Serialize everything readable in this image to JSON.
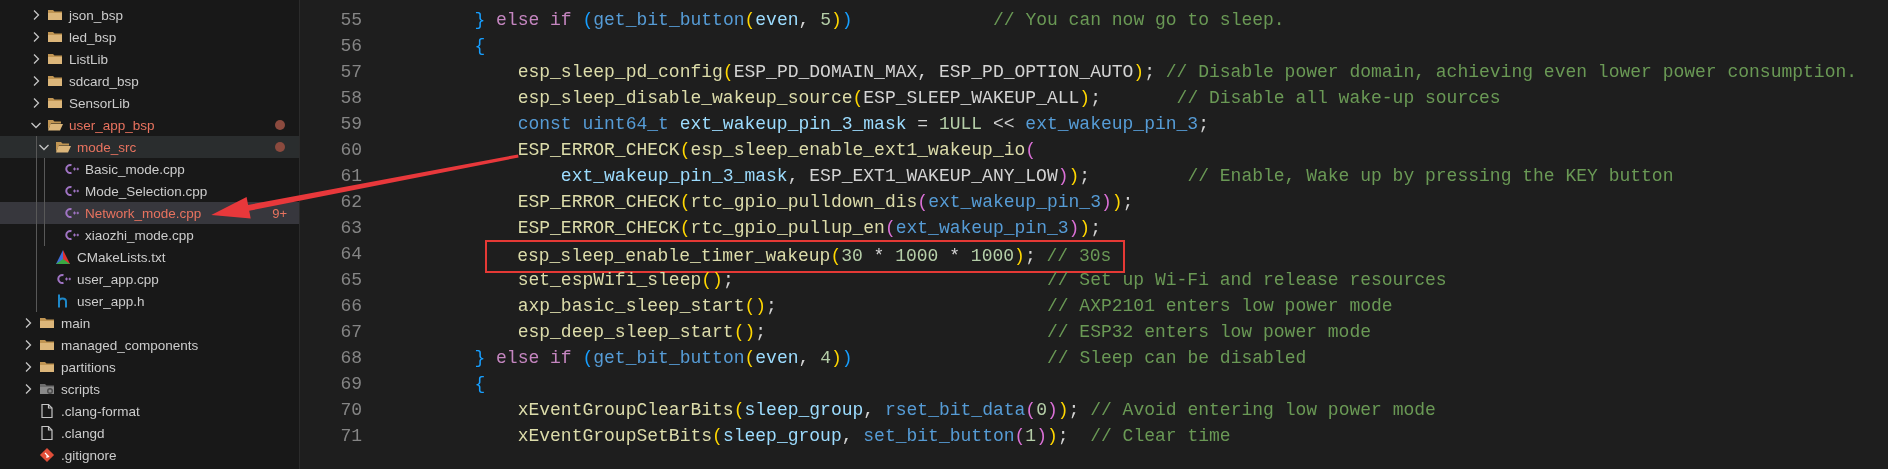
{
  "explorer": {
    "items": [
      {
        "children": [
          {
            "label": "json_bsp",
            "kind": "folder",
            "expanded": false,
            "modified": false,
            "selected": false,
            "hovered": false,
            "pointed": false
          },
          {
            "label": "led_bsp",
            "kind": "folder",
            "expanded": false,
            "modified": false,
            "selected": false,
            "hovered": false,
            "pointed": false
          },
          {
            "label": "ListLib",
            "kind": "folder",
            "expanded": false,
            "modified": false,
            "selected": false,
            "hovered": false,
            "pointed": false
          },
          {
            "label": "sdcard_bsp",
            "kind": "folder",
            "expanded": false,
            "modified": false,
            "selected": false,
            "hovered": false,
            "pointed": false
          },
          {
            "label": "SensorLib",
            "kind": "folder",
            "expanded": false,
            "modified": false,
            "selected": false,
            "hovered": false,
            "pointed": false
          },
          {
            "label": "user_app_bsp",
            "kind": "folder",
            "expanded": true,
            "modified": true,
            "selected": false,
            "hovered": false,
            "pointed": false,
            "children": [
              {
                "label": "mode_src",
                "kind": "folder",
                "expanded": true,
                "modified": true,
                "selected": false,
                "hovered": true,
                "pointed": false,
                "children": [
                  {
                    "label": "Basic_mode.cpp",
                    "kind": "cpp",
                    "modified": false,
                    "selected": false,
                    "hovered": false,
                    "pointed": false
                  },
                  {
                    "label": "Mode_Selection.cpp",
                    "kind": "cpp",
                    "modified": false,
                    "selected": false,
                    "hovered": false,
                    "pointed": false
                  },
                  {
                    "label": "Network_mode.cpp",
                    "kind": "cpp",
                    "modified": true,
                    "selected": true,
                    "hovered": false,
                    "pointed": true,
                    "badge": "9+"
                  },
                  {
                    "label": "xiaozhi_mode.cpp",
                    "kind": "cpp",
                    "modified": false,
                    "selected": false,
                    "hovered": false,
                    "pointed": false
                  }
                ]
              },
              {
                "label": "CMakeLists.txt",
                "kind": "cmake",
                "modified": false,
                "selected": false,
                "hovered": false,
                "pointed": false
              },
              {
                "label": "user_app.cpp",
                "kind": "cpp",
                "modified": false,
                "selected": false,
                "hovered": false,
                "pointed": false
              },
              {
                "label": "user_app.h",
                "kind": "header",
                "modified": false,
                "selected": false,
                "hovered": false,
                "pointed": false
              }
            ]
          }
        ]
      },
      {
        "label": "main",
        "kind": "folder",
        "expanded": false,
        "modified": false,
        "selected": false,
        "hovered": false,
        "pointed": false
      },
      {
        "label": "managed_components",
        "kind": "folder",
        "expanded": false,
        "modified": false,
        "selected": false,
        "hovered": false,
        "pointed": false
      },
      {
        "label": "partitions",
        "kind": "folder",
        "expanded": false,
        "modified": false,
        "selected": false,
        "hovered": false,
        "pointed": false
      },
      {
        "label": "scripts",
        "kind": "scripts",
        "expanded": false,
        "modified": false,
        "selected": false,
        "hovered": false,
        "pointed": false
      },
      {
        "label": ".clang-format",
        "kind": "file",
        "modified": false,
        "selected": false,
        "hovered": false,
        "pointed": false
      },
      {
        "label": ".clangd",
        "kind": "file",
        "modified": false,
        "selected": false,
        "hovered": false,
        "pointed": false
      },
      {
        "label": ".gitignore",
        "kind": "git",
        "modified": false,
        "selected": false,
        "hovered": false,
        "pointed": false
      }
    ]
  },
  "editor": {
    "lines": [
      {
        "number": "55",
        "highlighted": false,
        "tokens": [
          {
            "kind": "b3",
            "text": "        }"
          },
          {
            "kind": "kw",
            "text": " else if "
          },
          {
            "kind": "b3",
            "text": "("
          },
          {
            "kind": "blue",
            "text": "get_bit_button"
          },
          {
            "kind": "b1",
            "text": "("
          },
          {
            "kind": "var",
            "text": "even"
          },
          {
            "kind": "plain",
            "text": ", "
          },
          {
            "kind": "num",
            "text": "5"
          },
          {
            "kind": "b1",
            "text": ")"
          },
          {
            "kind": "b3",
            "text": ")             "
          },
          {
            "kind": "cm",
            "text": "// You can now go to sleep."
          }
        ]
      },
      {
        "number": "56",
        "highlighted": false,
        "tokens": [
          {
            "kind": "b3",
            "text": "        {"
          }
        ]
      },
      {
        "number": "57",
        "highlighted": false,
        "tokens": [
          {
            "kind": "fn",
            "text": "            esp_sleep_pd_config"
          },
          {
            "kind": "b1",
            "text": "("
          },
          {
            "kind": "plain",
            "text": "ESP_PD_DOMAIN_MAX, ESP_PD_OPTION_AUTO"
          },
          {
            "kind": "b1",
            "text": ")"
          },
          {
            "kind": "plain",
            "text": "; "
          },
          {
            "kind": "cm",
            "text": "// Disable power domain, achieving even lower power consumption."
          }
        ]
      },
      {
        "number": "58",
        "highlighted": false,
        "tokens": [
          {
            "kind": "fn",
            "text": "            esp_sleep_disable_wakeup_source"
          },
          {
            "kind": "b1",
            "text": "("
          },
          {
            "kind": "plain",
            "text": "ESP_SLEEP_WAKEUP_ALL"
          },
          {
            "kind": "b1",
            "text": ")"
          },
          {
            "kind": "plain",
            "text": ";       "
          },
          {
            "kind": "cm",
            "text": "// Disable all wake-up sources"
          }
        ]
      },
      {
        "number": "59",
        "highlighted": false,
        "tokens": [
          {
            "kind": "blue",
            "text": "            const uint64_t "
          },
          {
            "kind": "var",
            "text": "ext_wakeup_pin_3_mask"
          },
          {
            "kind": "plain",
            "text": " = "
          },
          {
            "kind": "num",
            "text": "1ULL"
          },
          {
            "kind": "plain",
            "text": " << "
          },
          {
            "kind": "blue",
            "text": "ext_wakeup_pin_3"
          },
          {
            "kind": "plain",
            "text": ";"
          }
        ]
      },
      {
        "number": "60",
        "highlighted": false,
        "tokens": [
          {
            "kind": "fn",
            "text": "            ESP_ERROR_CHECK"
          },
          {
            "kind": "b1",
            "text": "("
          },
          {
            "kind": "fn",
            "text": "esp_sleep_enable_ext1_wakeup_io"
          },
          {
            "kind": "b2",
            "text": "("
          }
        ]
      },
      {
        "number": "61",
        "highlighted": false,
        "tokens": [
          {
            "kind": "var",
            "text": "                ext_wakeup_pin_3_mask"
          },
          {
            "kind": "plain",
            "text": ", ESP_EXT1_WAKEUP_ANY_LOW"
          },
          {
            "kind": "b2",
            "text": ")"
          },
          {
            "kind": "b1",
            "text": ")"
          },
          {
            "kind": "plain",
            "text": ";         "
          },
          {
            "kind": "cm",
            "text": "// Enable, Wake up by pressing the KEY button"
          }
        ]
      },
      {
        "number": "62",
        "highlighted": false,
        "tokens": [
          {
            "kind": "fn",
            "text": "            ESP_ERROR_CHECK"
          },
          {
            "kind": "b1",
            "text": "("
          },
          {
            "kind": "fn",
            "text": "rtc_gpio_pulldown_dis"
          },
          {
            "kind": "b2",
            "text": "("
          },
          {
            "kind": "blue",
            "text": "ext_wakeup_pin_3"
          },
          {
            "kind": "b2",
            "text": ")"
          },
          {
            "kind": "b1",
            "text": ")"
          },
          {
            "kind": "plain",
            "text": ";"
          }
        ]
      },
      {
        "number": "63",
        "highlighted": false,
        "tokens": [
          {
            "kind": "fn",
            "text": "            ESP_ERROR_CHECK"
          },
          {
            "kind": "b1",
            "text": "("
          },
          {
            "kind": "fn",
            "text": "rtc_gpio_pullup_en"
          },
          {
            "kind": "b2",
            "text": "("
          },
          {
            "kind": "blue",
            "text": "ext_wakeup_pin_3"
          },
          {
            "kind": "b2",
            "text": ")"
          },
          {
            "kind": "b1",
            "text": ")"
          },
          {
            "kind": "plain",
            "text": ";"
          }
        ]
      },
      {
        "number": "64",
        "highlighted": true,
        "tokens": [
          {
            "kind": "fn",
            "text": "            esp_sleep_enable_timer_wakeup"
          },
          {
            "kind": "b1",
            "text": "("
          },
          {
            "kind": "num",
            "text": "30"
          },
          {
            "kind": "plain",
            "text": " * "
          },
          {
            "kind": "num",
            "text": "1000"
          },
          {
            "kind": "plain",
            "text": " * "
          },
          {
            "kind": "num",
            "text": "1000"
          },
          {
            "kind": "b1",
            "text": ")"
          },
          {
            "kind": "plain",
            "text": "; "
          },
          {
            "kind": "cm",
            "text": "// 30s"
          }
        ]
      },
      {
        "number": "65",
        "highlighted": false,
        "tokens": [
          {
            "kind": "fn",
            "text": "            set_espWifi_sleep"
          },
          {
            "kind": "b1",
            "text": "()"
          },
          {
            "kind": "plain",
            "text": ";                             "
          },
          {
            "kind": "cm",
            "text": "// Set up Wi-Fi and release resources"
          }
        ]
      },
      {
        "number": "66",
        "highlighted": false,
        "tokens": [
          {
            "kind": "fn",
            "text": "            axp_basic_sleep_start"
          },
          {
            "kind": "b1",
            "text": "()"
          },
          {
            "kind": "plain",
            "text": ";                         "
          },
          {
            "kind": "cm",
            "text": "// AXP2101 enters low power mode"
          }
        ]
      },
      {
        "number": "67",
        "highlighted": false,
        "tokens": [
          {
            "kind": "fn",
            "text": "            esp_deep_sleep_start"
          },
          {
            "kind": "b1",
            "text": "()"
          },
          {
            "kind": "plain",
            "text": ";                          "
          },
          {
            "kind": "cm",
            "text": "// ESP32 enters low power mode"
          }
        ]
      },
      {
        "number": "68",
        "highlighted": false,
        "tokens": [
          {
            "kind": "b3",
            "text": "        }"
          },
          {
            "kind": "kw",
            "text": " else if "
          },
          {
            "kind": "b3",
            "text": "("
          },
          {
            "kind": "blue",
            "text": "get_bit_button"
          },
          {
            "kind": "b1",
            "text": "("
          },
          {
            "kind": "var",
            "text": "even"
          },
          {
            "kind": "plain",
            "text": ", "
          },
          {
            "kind": "num",
            "text": "4"
          },
          {
            "kind": "b1",
            "text": ")"
          },
          {
            "kind": "b3",
            "text": ")                  "
          },
          {
            "kind": "cm",
            "text": "// Sleep can be disabled"
          }
        ]
      },
      {
        "number": "69",
        "highlighted": false,
        "tokens": [
          {
            "kind": "b3",
            "text": "        {"
          }
        ]
      },
      {
        "number": "70",
        "highlighted": false,
        "tokens": [
          {
            "kind": "fn",
            "text": "            xEventGroupClearBits"
          },
          {
            "kind": "b1",
            "text": "("
          },
          {
            "kind": "var",
            "text": "sleep_group"
          },
          {
            "kind": "plain",
            "text": ", "
          },
          {
            "kind": "blue",
            "text": "rset_bit_data"
          },
          {
            "kind": "b2",
            "text": "("
          },
          {
            "kind": "num",
            "text": "0"
          },
          {
            "kind": "b2",
            "text": ")"
          },
          {
            "kind": "b1",
            "text": ")"
          },
          {
            "kind": "plain",
            "text": "; "
          },
          {
            "kind": "cm",
            "text": "// Avoid entering low power mode"
          }
        ]
      },
      {
        "number": "71",
        "highlighted": false,
        "tokens": [
          {
            "kind": "fn",
            "text": "            xEventGroupSetBits"
          },
          {
            "kind": "b1",
            "text": "("
          },
          {
            "kind": "var",
            "text": "sleep_group"
          },
          {
            "kind": "plain",
            "text": ", "
          },
          {
            "kind": "blue",
            "text": "set_bit_button"
          },
          {
            "kind": "b2",
            "text": "("
          },
          {
            "kind": "num",
            "text": "1"
          },
          {
            "kind": "b2",
            "text": ")"
          },
          {
            "kind": "b1",
            "text": ")"
          },
          {
            "kind": "plain",
            "text": ";  "
          },
          {
            "kind": "cm",
            "text": "// Clear time"
          }
        ]
      }
    ]
  }
}
